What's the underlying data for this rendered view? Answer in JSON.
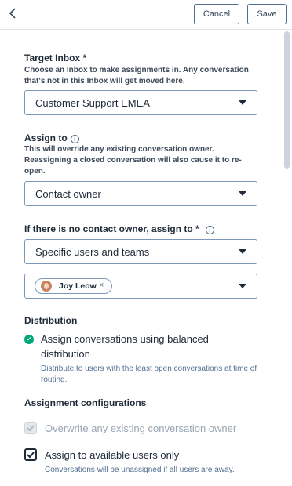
{
  "toolbar": {
    "cancel_label": "Cancel",
    "save_label": "Save"
  },
  "target_inbox": {
    "label": "Target Inbox *",
    "description": "Choose an Inbox to make assignments in. Any conversation that's not in this Inbox will get moved here.",
    "selected": "Customer Support EMEA"
  },
  "assign_to": {
    "label": "Assign to",
    "description": "This will override any existing conversation owner. Reassigning a closed conversation will also cause it to re-open.",
    "selected": "Contact owner"
  },
  "fallback": {
    "label": "If there is no contact owner, assign to *",
    "selected": "Specific users and teams",
    "users": [
      {
        "name": "Joy Leow"
      }
    ],
    "remove_glyph": "×"
  },
  "distribution": {
    "label": "Distribution",
    "option_label": "Assign conversations using balanced distribution",
    "option_description": "Distribute to users with the least open conversations at time of routing."
  },
  "assignment_configurations": {
    "label": "Assignment configurations",
    "overwrite_label": "Overwrite any existing conversation owner",
    "overwrite_checked": true,
    "overwrite_disabled": true,
    "available_label": "Assign to available users only",
    "available_checked": true,
    "available_description": "Conversations will be unassigned if all users are away."
  },
  "colors": {
    "accent": "#00a878",
    "text": "#33475b",
    "border": "#7c98b6"
  },
  "icons": {
    "back": "chevron-left-icon",
    "info": "info-icon",
    "caret": "caret-down-icon"
  }
}
